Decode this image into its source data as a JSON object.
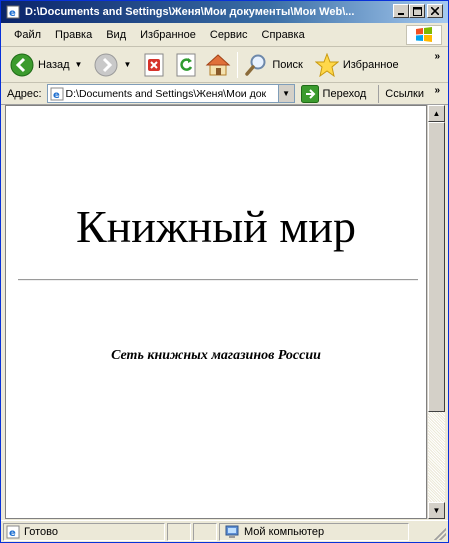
{
  "window": {
    "title": "D:\\Documents and Settings\\Женя\\Мои документы\\Мои Web\\..."
  },
  "menu": {
    "items": [
      "Файл",
      "Правка",
      "Вид",
      "Избранное",
      "Сервис",
      "Справка"
    ]
  },
  "toolbar": {
    "back_label": "Назад",
    "search_label": "Поиск",
    "favorites_label": "Избранное"
  },
  "address": {
    "label": "Адрес:",
    "value": "D:\\Documents and Settings\\Женя\\Мои док",
    "go_label": "Переход",
    "links_label": "Ссылки"
  },
  "page": {
    "heading": "Книжный мир",
    "subtitle": "Сеть книжных магазинов России"
  },
  "status": {
    "text": "Готово",
    "zone": "Мой компьютер"
  },
  "colors": {
    "titlebar_start": "#0a246a",
    "titlebar_end": "#a6caf0",
    "chrome": "#ece9d8",
    "content_bg": "#ffffff"
  },
  "icons": [
    "ie-page-icon",
    "minimize-icon",
    "maximize-icon",
    "close-icon",
    "windows-logo-icon",
    "back-arrow-icon",
    "forward-arrow-icon",
    "stop-icon",
    "refresh-icon",
    "home-icon",
    "search-icon",
    "favorites-star-icon",
    "go-arrow-icon",
    "computer-icon"
  ]
}
